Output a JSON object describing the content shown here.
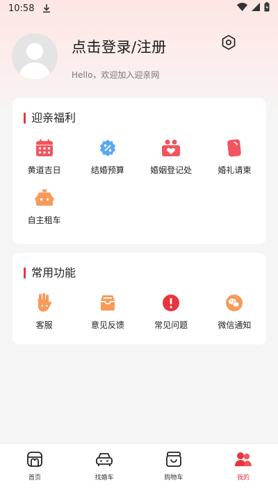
{
  "status_bar": {
    "time": "10:58"
  },
  "header": {
    "login_title": "点击登录/注册",
    "welcome": "Hello，欢迎加入迎亲网"
  },
  "welfare": {
    "title": "迎亲福利",
    "items": [
      {
        "label": "黄道吉日",
        "icon": "calendar-icon"
      },
      {
        "label": "结婚预算",
        "icon": "discount-badge-icon"
      },
      {
        "label": "婚姻登记处",
        "icon": "marriage-registry-icon"
      },
      {
        "label": "婚礼请柬",
        "icon": "invitation-icon"
      },
      {
        "label": "自主租车",
        "icon": "car-rental-icon"
      }
    ]
  },
  "functions": {
    "title": "常用功能",
    "items": [
      {
        "label": "客服",
        "icon": "customer-service-icon"
      },
      {
        "label": "意见反馈",
        "icon": "feedback-tray-icon"
      },
      {
        "label": "常见问题",
        "icon": "faq-alert-icon"
      },
      {
        "label": "微信通知",
        "icon": "wechat-icon"
      }
    ]
  },
  "bottom_nav": [
    {
      "label": "首页",
      "icon": "home-icon"
    },
    {
      "label": "找婚车",
      "icon": "wedding-car-icon"
    },
    {
      "label": "购物车",
      "icon": "cart-icon"
    },
    {
      "label": "我的",
      "icon": "profile-icon"
    }
  ],
  "colors": {
    "accent": "#e8343f",
    "icon_red": "#f2555e",
    "icon_orange": "#f79a5a",
    "icon_blue": "#5aa9f2"
  }
}
